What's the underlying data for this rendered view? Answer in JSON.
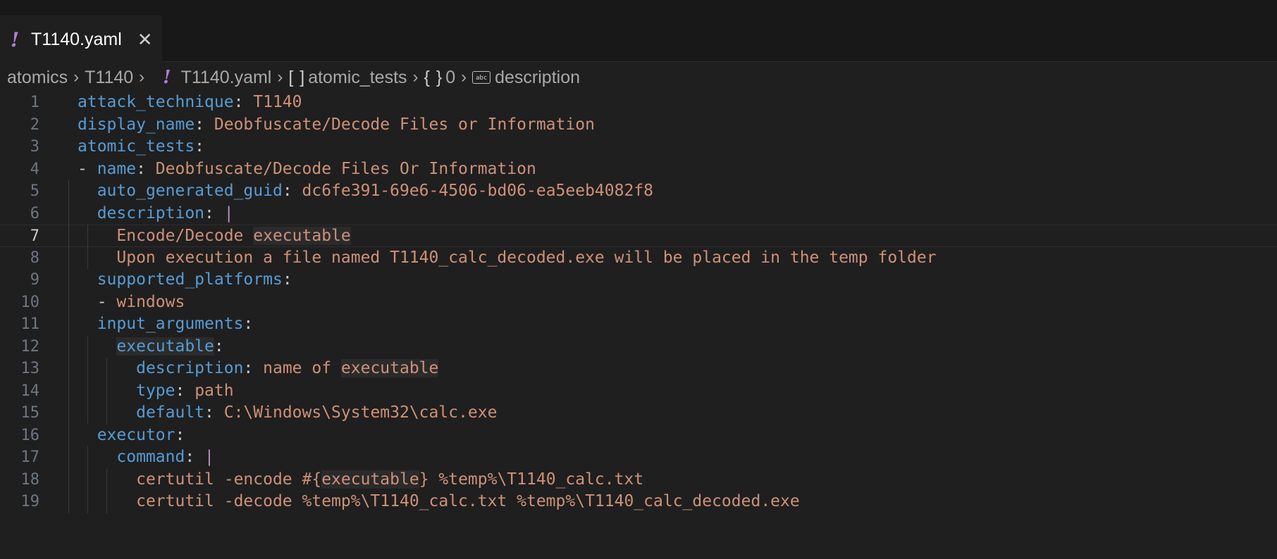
{
  "tab": {
    "title": "T1140.yaml",
    "icon": "!",
    "close": "✕"
  },
  "breadcrumb": {
    "items": [
      "atomics",
      "T1140",
      "T1140.yaml",
      "atomic_tests",
      "0",
      "description"
    ],
    "separator": "›",
    "array_symbol": "[ ]",
    "object_symbol": "{ }",
    "string_symbol": "abc"
  },
  "editor": {
    "lines": [
      {
        "n": "1",
        "parts": [
          [
            "key",
            "attack_technique"
          ],
          [
            "punct",
            ": "
          ],
          [
            "str",
            "T1140"
          ]
        ]
      },
      {
        "n": "2",
        "parts": [
          [
            "key",
            "display_name"
          ],
          [
            "punct",
            ": "
          ],
          [
            "str",
            "Deobfuscate/Decode Files or Information"
          ]
        ]
      },
      {
        "n": "3",
        "parts": [
          [
            "key",
            "atomic_tests"
          ],
          [
            "punct",
            ":"
          ]
        ]
      },
      {
        "n": "4",
        "parts": [
          [
            "punct",
            "- "
          ],
          [
            "key",
            "name"
          ],
          [
            "punct",
            ": "
          ],
          [
            "str",
            "Deobfuscate/Decode Files Or Information"
          ]
        ]
      },
      {
        "n": "5",
        "parts": [
          [
            "punct",
            "  "
          ],
          [
            "key",
            "auto_generated_guid"
          ],
          [
            "punct",
            ": "
          ],
          [
            "str",
            "dc6fe391-69e6-4506-bd06-ea5eeb4082f8"
          ]
        ]
      },
      {
        "n": "6",
        "parts": [
          [
            "punct",
            "  "
          ],
          [
            "key",
            "description"
          ],
          [
            "punct",
            ": "
          ],
          [
            "pipe",
            "|"
          ]
        ]
      },
      {
        "n": "7",
        "parts": [
          [
            "punct",
            "    "
          ],
          [
            "str",
            "Encode/Decode "
          ],
          [
            "str hl",
            "executable"
          ]
        ]
      },
      {
        "n": "8",
        "parts": [
          [
            "punct",
            "    "
          ],
          [
            "str",
            "Upon execution a file named T1140_calc_decoded.exe will be placed in the temp folder"
          ]
        ]
      },
      {
        "n": "9",
        "parts": [
          [
            "punct",
            "  "
          ],
          [
            "key",
            "supported_platforms"
          ],
          [
            "punct",
            ":"
          ]
        ]
      },
      {
        "n": "10",
        "parts": [
          [
            "punct",
            "  - "
          ],
          [
            "str",
            "windows"
          ]
        ]
      },
      {
        "n": "11",
        "parts": [
          [
            "punct",
            "  "
          ],
          [
            "key",
            "input_arguments"
          ],
          [
            "punct",
            ":"
          ]
        ]
      },
      {
        "n": "12",
        "parts": [
          [
            "punct",
            "    "
          ],
          [
            "key hl",
            "executable"
          ],
          [
            "punct",
            ":"
          ]
        ]
      },
      {
        "n": "13",
        "parts": [
          [
            "punct",
            "      "
          ],
          [
            "key",
            "description"
          ],
          [
            "punct",
            ": "
          ],
          [
            "str",
            "name of "
          ],
          [
            "str hl",
            "executable"
          ]
        ]
      },
      {
        "n": "14",
        "parts": [
          [
            "punct",
            "      "
          ],
          [
            "key",
            "type"
          ],
          [
            "punct",
            ": "
          ],
          [
            "str",
            "path"
          ]
        ]
      },
      {
        "n": "15",
        "parts": [
          [
            "punct",
            "      "
          ],
          [
            "key",
            "default"
          ],
          [
            "punct",
            ": "
          ],
          [
            "str",
            "C:\\Windows\\System32\\calc.exe"
          ]
        ]
      },
      {
        "n": "16",
        "parts": [
          [
            "punct",
            "  "
          ],
          [
            "key",
            "executor"
          ],
          [
            "punct",
            ":"
          ]
        ]
      },
      {
        "n": "17",
        "parts": [
          [
            "punct",
            "    "
          ],
          [
            "key",
            "command"
          ],
          [
            "punct",
            ": "
          ],
          [
            "pipe",
            "|"
          ]
        ]
      },
      {
        "n": "18",
        "parts": [
          [
            "punct",
            "      "
          ],
          [
            "str",
            "certutil -encode #{"
          ],
          [
            "str hl",
            "executable"
          ],
          [
            "str",
            "} %temp%\\T1140_calc.txt"
          ]
        ]
      },
      {
        "n": "19",
        "parts": [
          [
            "punct",
            "      "
          ],
          [
            "str",
            "certutil -decode %temp%\\T1140_calc.txt %temp%\\T1140_calc_decoded.exe"
          ]
        ]
      }
    ],
    "current_line": "7"
  },
  "colors": {
    "background": "#1f1f1f",
    "key": "#569cd6",
    "string": "#ce9178",
    "yaml_icon": "#b180d7"
  }
}
